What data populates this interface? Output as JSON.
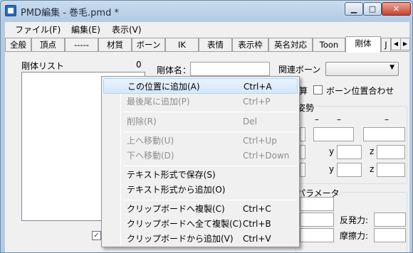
{
  "window": {
    "title": "PMD編集 - 巻毛.pmd *",
    "min_label": "▁",
    "max_label": "□",
    "close_label": "✕"
  },
  "menubar": [
    "ファイル(F)",
    "編集(E)",
    "表示(V)"
  ],
  "tabs": [
    "全般",
    "頂点",
    "-----",
    "材質",
    "ボーン",
    "IK",
    "表情",
    "表示枠",
    "英名対応",
    "Toon",
    "剛体",
    "J"
  ],
  "active_tab": "剛体",
  "rigidbody": {
    "list_label": "剛体リスト",
    "count": "0",
    "name_label": "剛体名：",
    "related_bone_label": "関連ボーン",
    "calc_button_tail": "算",
    "bone_position_label": "ボーン位置合わせ",
    "posture_tail": "姿勢",
    "dash_labels": [
      "–",
      "–",
      "–"
    ],
    "axis_labels": [
      "y",
      "z",
      "y",
      "z"
    ],
    "params_tail": "パラメータ",
    "restitution_label": "反発力:",
    "friction_label": "摩擦力:"
  },
  "context_menu": {
    "items": [
      {
        "text": "この位置に追加(A)",
        "shortcut": "Ctrl+A",
        "enabled": true,
        "highlighted": true
      },
      {
        "text": "最後尾に追加(P)",
        "shortcut": "Ctrl+P",
        "enabled": false
      },
      {
        "text": "削除(R)",
        "shortcut": "Del",
        "enabled": false
      },
      {
        "text": "上へ移動(U)",
        "shortcut": "Ctrl+Up",
        "enabled": false
      },
      {
        "text": "下へ移動(D)",
        "shortcut": "Ctrl+Down",
        "enabled": false
      },
      {
        "text": "テキスト形式で保存(S)",
        "shortcut": "",
        "enabled": true
      },
      {
        "text": "テキスト形式から追加(O)",
        "shortcut": "",
        "enabled": true
      },
      {
        "text": "クリップボードへ複製(C)",
        "shortcut": "Ctrl+C",
        "enabled": true
      },
      {
        "text": "クリップボードへ全て複製(C)",
        "shortcut": "Ctrl+B",
        "enabled": true
      },
      {
        "text": "クリップボードから追加(V)",
        "shortcut": "Ctrl+V",
        "enabled": true
      }
    ]
  },
  "colors": {
    "highlight": "#d4e7fb",
    "disabled_text": "#8d8d8d",
    "title_bar": "#b3cbe4"
  }
}
